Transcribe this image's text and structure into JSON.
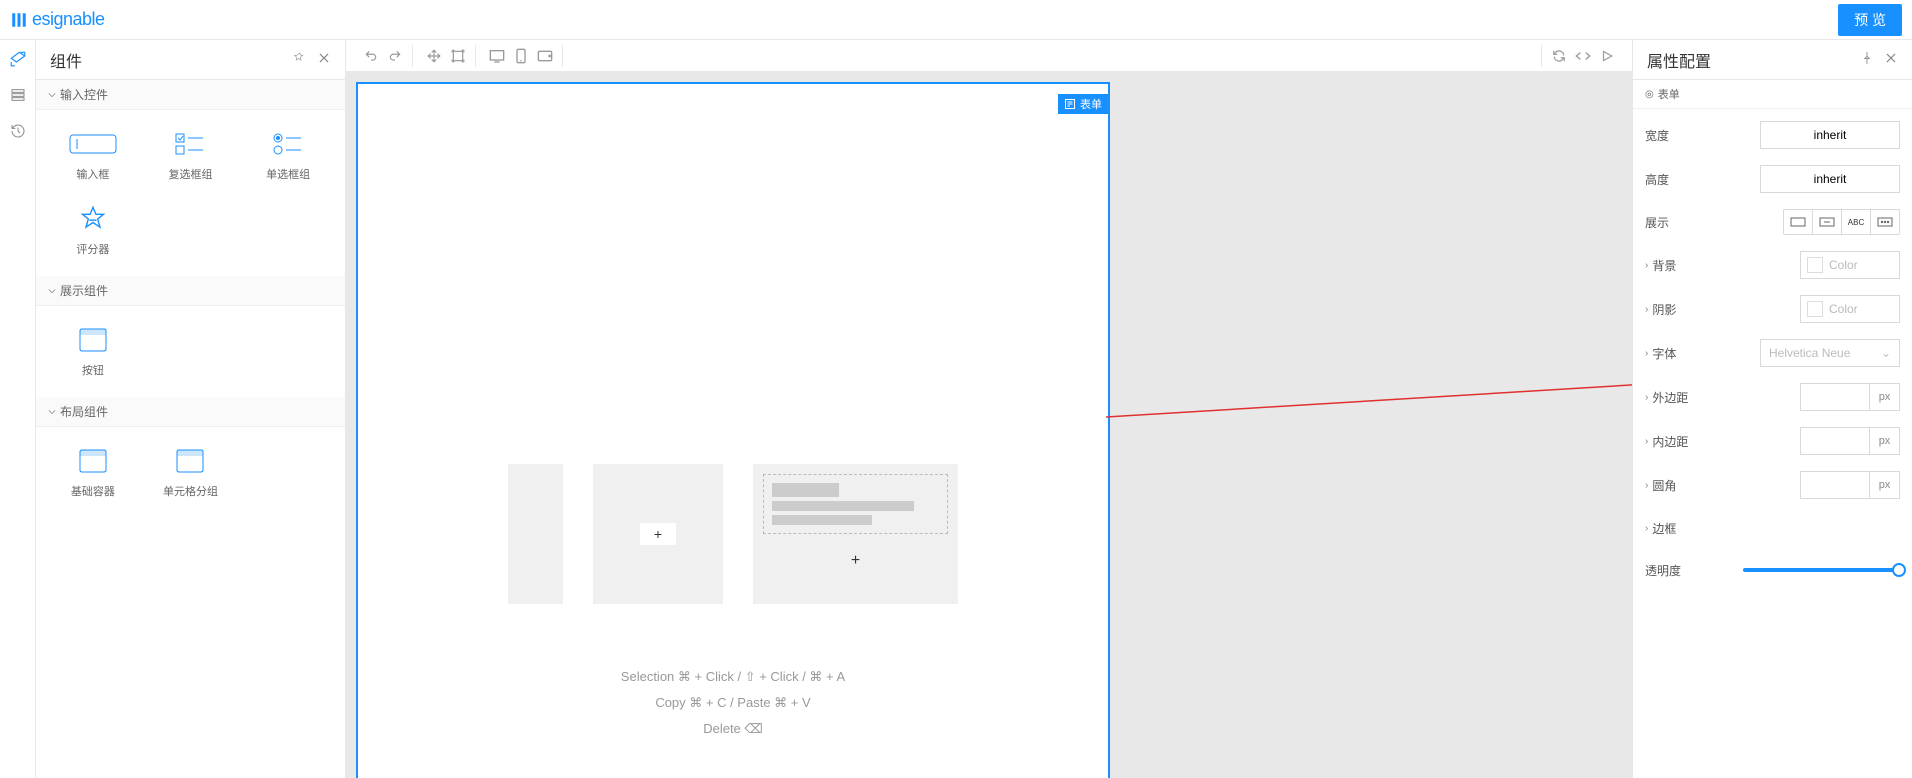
{
  "header": {
    "brand": "esignable",
    "preview_label": "预 览"
  },
  "left": {
    "title": "组件",
    "sections": [
      {
        "title": "输入控件",
        "items": [
          "输入框",
          "复选框组",
          "单选框组",
          "评分器"
        ]
      },
      {
        "title": "展示组件",
        "items": [
          "按钮"
        ]
      },
      {
        "title": "布局组件",
        "items": [
          "基础容器",
          "单元格分组"
        ]
      }
    ]
  },
  "canvas": {
    "selection_label": "表单",
    "hints": [
      "Selection ⌘ + Click / ⇧ + Click / ⌘ + A",
      "Copy ⌘ + C / Paste ⌘ + V",
      "Delete ⌫"
    ]
  },
  "right": {
    "title": "属性配置",
    "crumb": "表单",
    "props": {
      "width_label": "宽度",
      "width_value": "inherit",
      "height_label": "高度",
      "height_value": "inherit",
      "display_label": "展示",
      "bg_label": "背景",
      "bg_placeholder": "Color",
      "shadow_label": "阴影",
      "shadow_placeholder": "Color",
      "font_label": "字体",
      "font_placeholder": "Helvetica Neue",
      "margin_label": "外边距",
      "margin_unit": "px",
      "padding_label": "内边距",
      "padding_unit": "px",
      "radius_label": "圆角",
      "radius_unit": "px",
      "border_label": "边框",
      "opacity_label": "透明度"
    },
    "display_segments": [
      "▭",
      "⊞",
      "ABC",
      "⋯"
    ]
  }
}
